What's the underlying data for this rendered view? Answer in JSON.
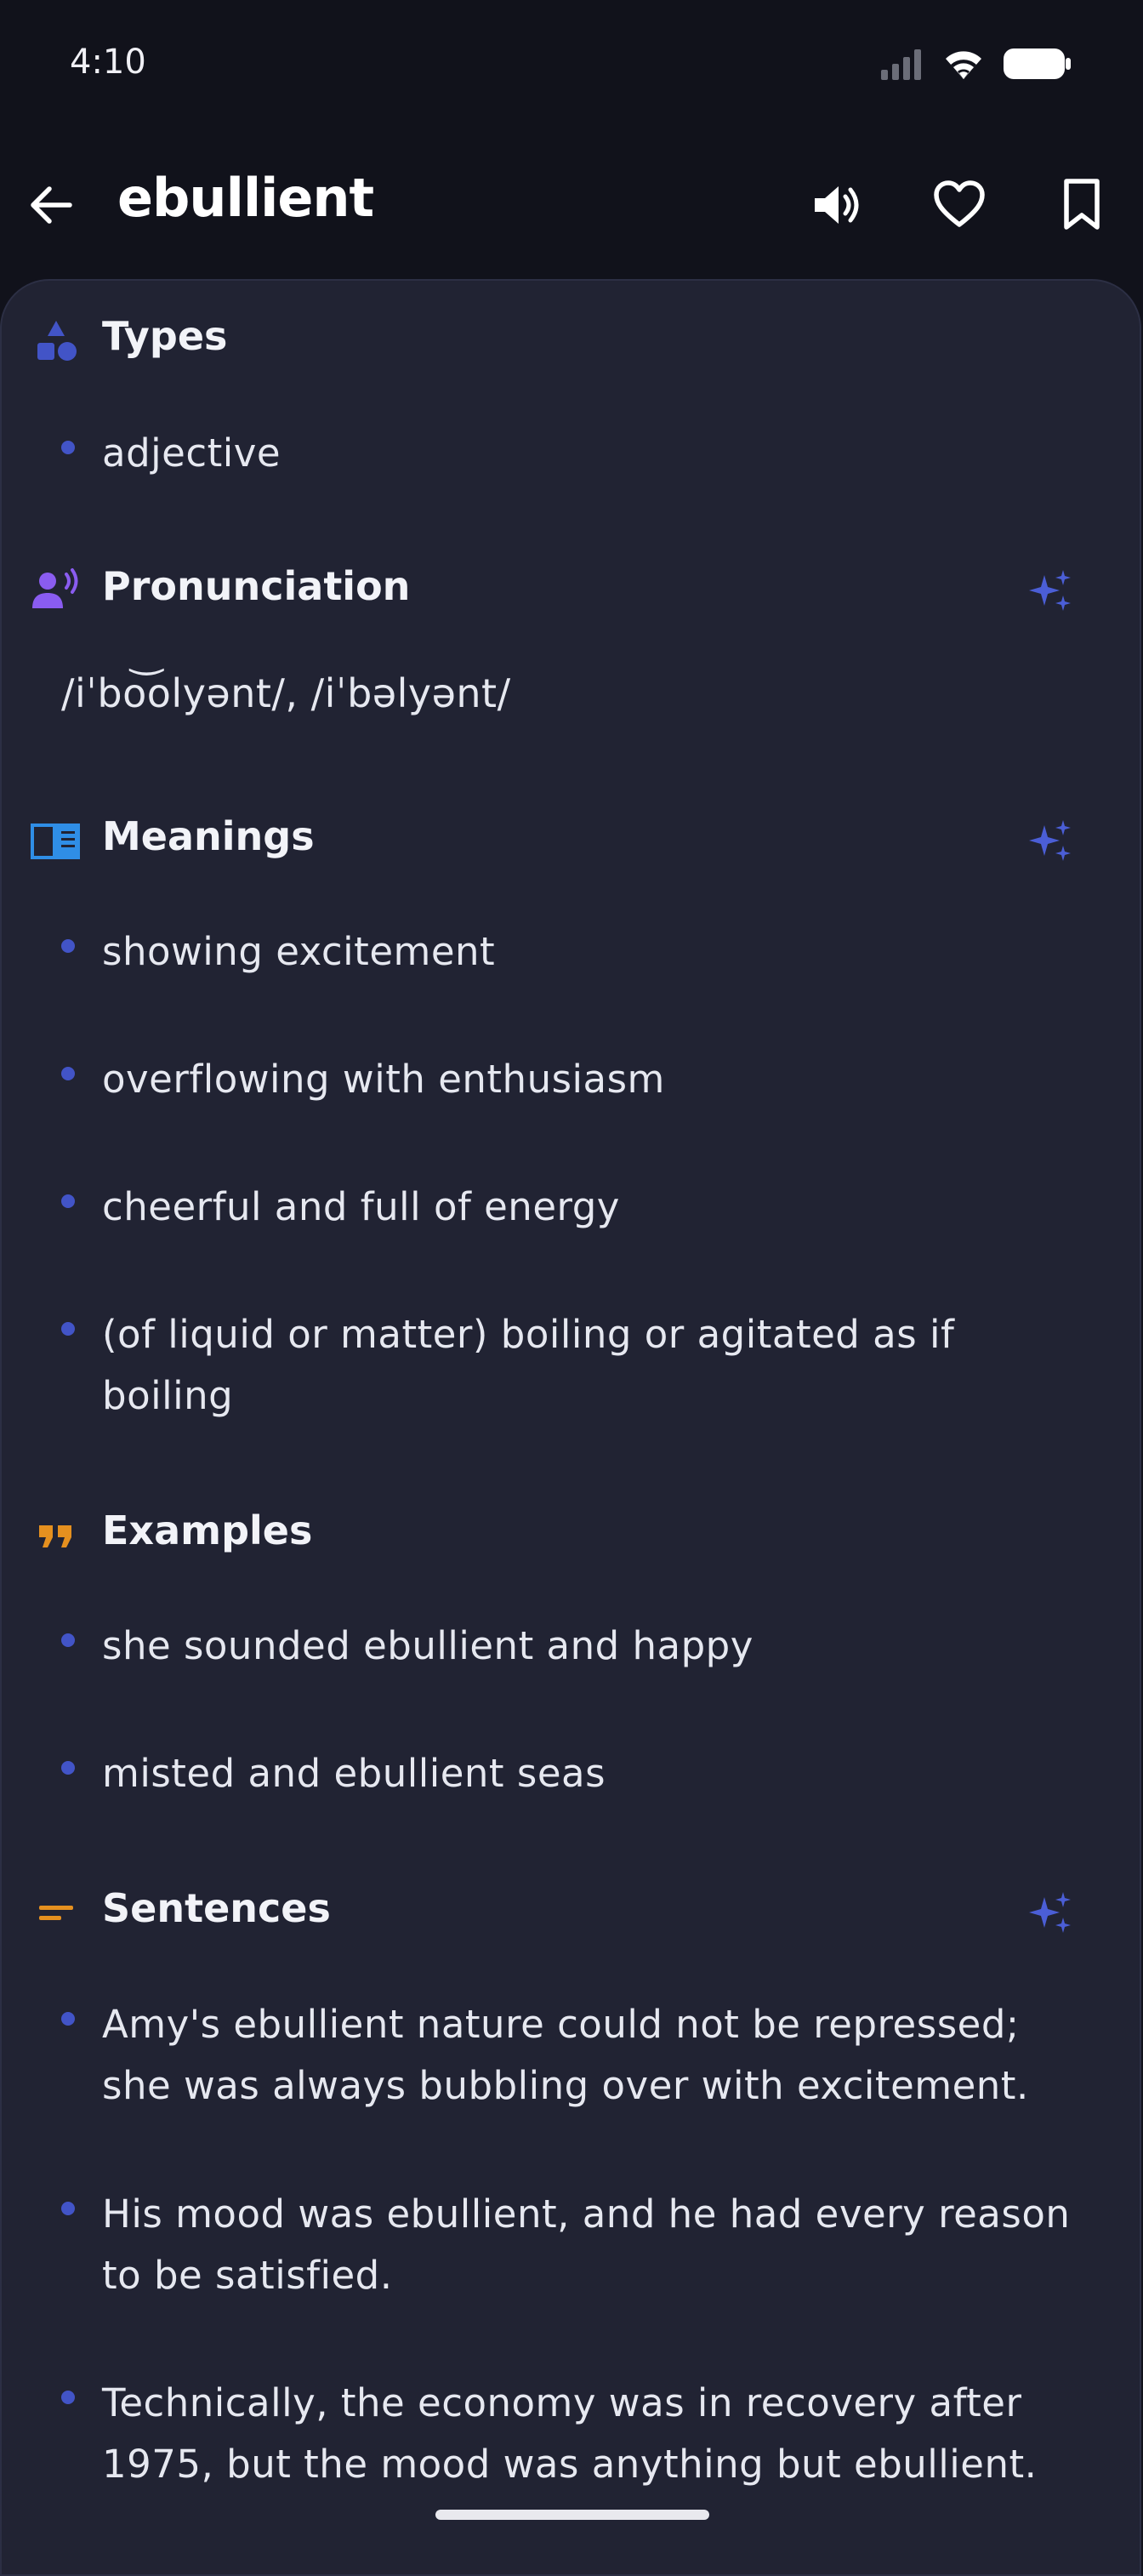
{
  "status_bar": {
    "time": "4:10",
    "icons": [
      "signal-icon",
      "wifi-icon",
      "battery-icon"
    ]
  },
  "app_bar": {
    "title": "ebullient",
    "actions": [
      "speaker-icon",
      "heart-icon",
      "bookmark-icon"
    ]
  },
  "sections": {
    "types": {
      "title": "Types",
      "icon": "shapes-icon",
      "items": [
        "adjective"
      ]
    },
    "pronunciation": {
      "title": "Pronunciation",
      "icon": "speaking-person-icon",
      "text": "/iˈbo͝olyənt/, /iˈbəlyənt/"
    },
    "meanings": {
      "title": "Meanings",
      "icon": "book-icon",
      "items": [
        "showing excitement",
        "overflowing with enthusiasm",
        "cheerful and full of energy",
        "(of liquid or matter) boiling or agitated as if boiling"
      ]
    },
    "examples": {
      "title": "Examples",
      "icon": "quote-icon",
      "items": [
        "she sounded ebullient and happy",
        "misted and ebullient seas"
      ]
    },
    "sentences": {
      "title": "Sentences",
      "icon": "lines-icon",
      "items": [
        "Amy's ebullient nature could not be repressed; she was always bubbling over with excitement.",
        "His mood was ebullient, and he had every reason to be satisfied.",
        "Technically, the economy was in recovery after 1975, but the mood was anything but ebullient."
      ]
    }
  },
  "colors": {
    "background": "#11121b",
    "card": "#212333",
    "accent_blue": "#4254c7",
    "accent_purple": "#8a5cf0",
    "accent_orange": "#e5901f",
    "text": "#e6e8f0"
  }
}
